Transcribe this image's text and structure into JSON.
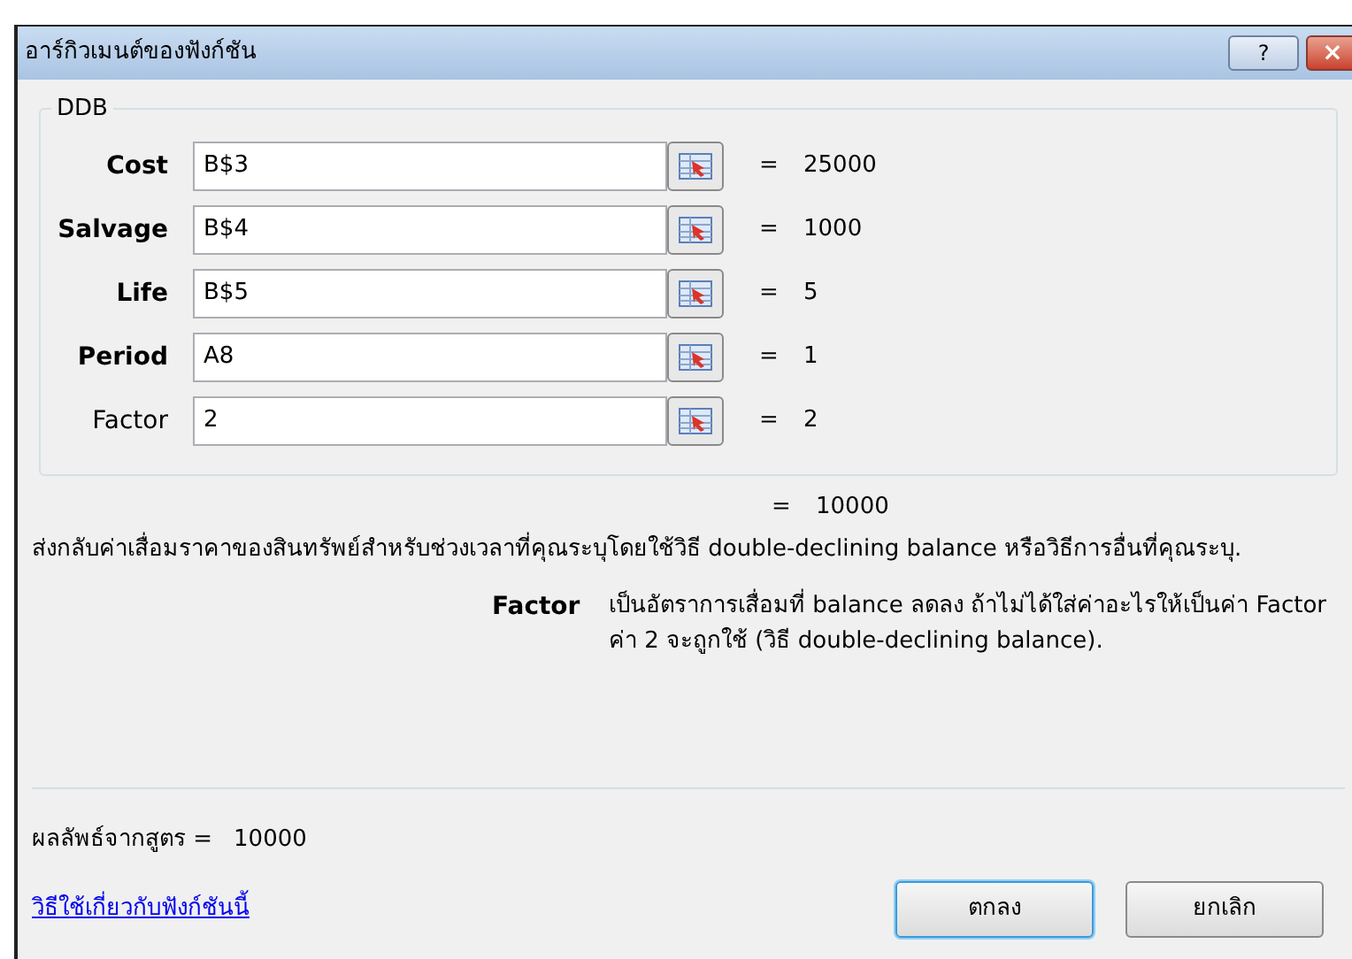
{
  "window": {
    "title": "อาร์กิวเมนต์ของฟังก์ชัน",
    "help_button": "?",
    "close_button": "×"
  },
  "function": {
    "name": "DDB",
    "arguments": [
      {
        "label": "Cost",
        "required": true,
        "value": "B$3",
        "equals": "=",
        "result": "25000"
      },
      {
        "label": "Salvage",
        "required": true,
        "value": "B$4",
        "equals": "=",
        "result": "1000"
      },
      {
        "label": "Life",
        "required": true,
        "value": "B$5",
        "equals": "=",
        "result": "5"
      },
      {
        "label": "Period",
        "required": true,
        "value": "A8",
        "equals": "=",
        "result": "1"
      },
      {
        "label": "Factor",
        "required": false,
        "value": "2",
        "equals": "=",
        "result": "2"
      }
    ],
    "equals": "=",
    "result": "10000"
  },
  "description": "ส่งกลับค่าเสื่อมราคาของสินทรัพย์สำหรับช่วงเวลาที่คุณระบุโดยใช้วิธี double-declining balance หรือวิธีการอื่นที่คุณระบุ.",
  "argument_help": {
    "name": "Factor",
    "text": "เป็นอัตราการเสื่อมที่ balance ลดลง ถ้าไม่ได้ใส่ค่าอะไรให้เป็นค่า Factor  ค่า 2 จะถูกใช้ (วิธี double-declining balance)."
  },
  "formula_result": {
    "label": "ผลลัพธ์จากสูตร =",
    "value": "10000"
  },
  "help_link": "วิธีใช้เกี่ยวกับฟังก์ชันนี้",
  "buttons": [
    {
      "label": "ตกลง",
      "default": true
    },
    {
      "label": "ยกเลิก",
      "default": false
    }
  ]
}
